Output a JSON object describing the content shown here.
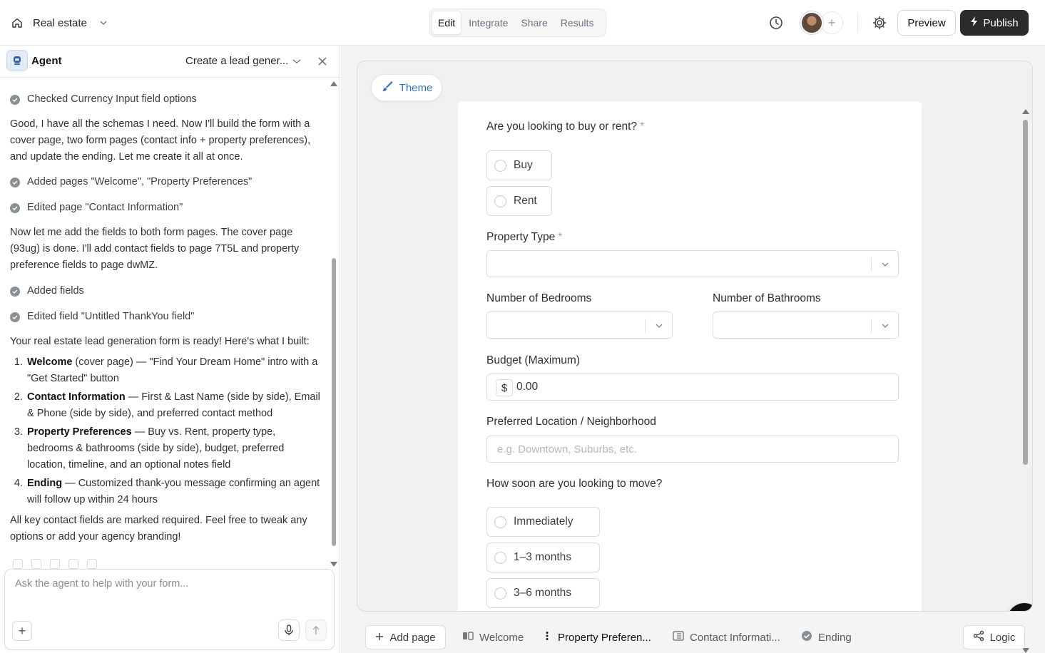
{
  "header": {
    "workspace": "Real estate",
    "tabs": [
      "Edit",
      "Integrate",
      "Share",
      "Results"
    ],
    "active_tab": "Edit",
    "preview_label": "Preview",
    "publish_label": "Publish"
  },
  "agent": {
    "title": "Agent",
    "conversation_select": "Create a lead gener...",
    "log": {
      "step1": "Checked Currency Input field options",
      "para1": "Good, I have all the schemas I need. Now I'll build the form with a cover page, two form pages (contact info + property preferences), and update the ending. Let me create it all at once.",
      "step2": "Added pages \"Welcome\", \"Property Preferences\"",
      "step3": "Edited page \"Contact Information\"",
      "para2": "Now let me add the fields to both form pages. The cover page (93ug) is done. I'll add contact fields to page 7T5L and property preference fields to page dwMZ.",
      "step4": "Added fields",
      "step5": "Edited field \"Untitled ThankYou field\"",
      "para3": "Your real estate lead generation form is ready! Here's what I built:",
      "list": [
        {
          "num": "1.",
          "bold": "Welcome",
          "text": " (cover page) — \"Find Your Dream Home\" intro with a \"Get Started\" button"
        },
        {
          "num": "2.",
          "bold": "Contact Information",
          "text": " — First & Last Name (side by side), Email & Phone (side by side), and preferred contact method"
        },
        {
          "num": "3.",
          "bold": "Property Preferences",
          "text": " — Buy vs. Rent, property type, bedrooms & bathrooms (side by side), budget, preferred location, timeline, and an optional notes field"
        },
        {
          "num": "4.",
          "bold": "Ending",
          "text": " — Customized thank-you message confirming an agent will follow up within 24 hours"
        }
      ],
      "para4": "All key contact fields are marked required. Feel free to tweak any options or add your agency branding!"
    },
    "composer_placeholder": "Ask the agent to help with your form..."
  },
  "canvas": {
    "theme_label": "Theme",
    "q_buy_rent": "Are you looking to buy or rent?",
    "required_mark": "*",
    "opt_buy": "Buy",
    "opt_rent": "Rent",
    "q_property_type": "Property Type",
    "q_bedrooms": "Number of Bedrooms",
    "q_bathrooms": "Number of Bathrooms",
    "q_budget": "Budget (Maximum)",
    "currency_symbol": "$",
    "budget_value": "0.00",
    "q_location": "Preferred Location / Neighborhood",
    "location_placeholder": "e.g. Downtown, Suburbs, etc.",
    "q_move": "How soon are you looking to move?",
    "opt_immediately": "Immediately",
    "opt_1_3": "1–3 months",
    "opt_3_6": "3–6 months"
  },
  "pages": {
    "add_page": "Add page",
    "items": [
      "Welcome",
      "Property Preferen...",
      "Contact Informati...",
      "Ending"
    ],
    "active": "Property Preferen...",
    "logic_label": "Logic"
  },
  "colors": {
    "accent": "#2f6fd3",
    "publish_bg": "#2b2b2b"
  }
}
